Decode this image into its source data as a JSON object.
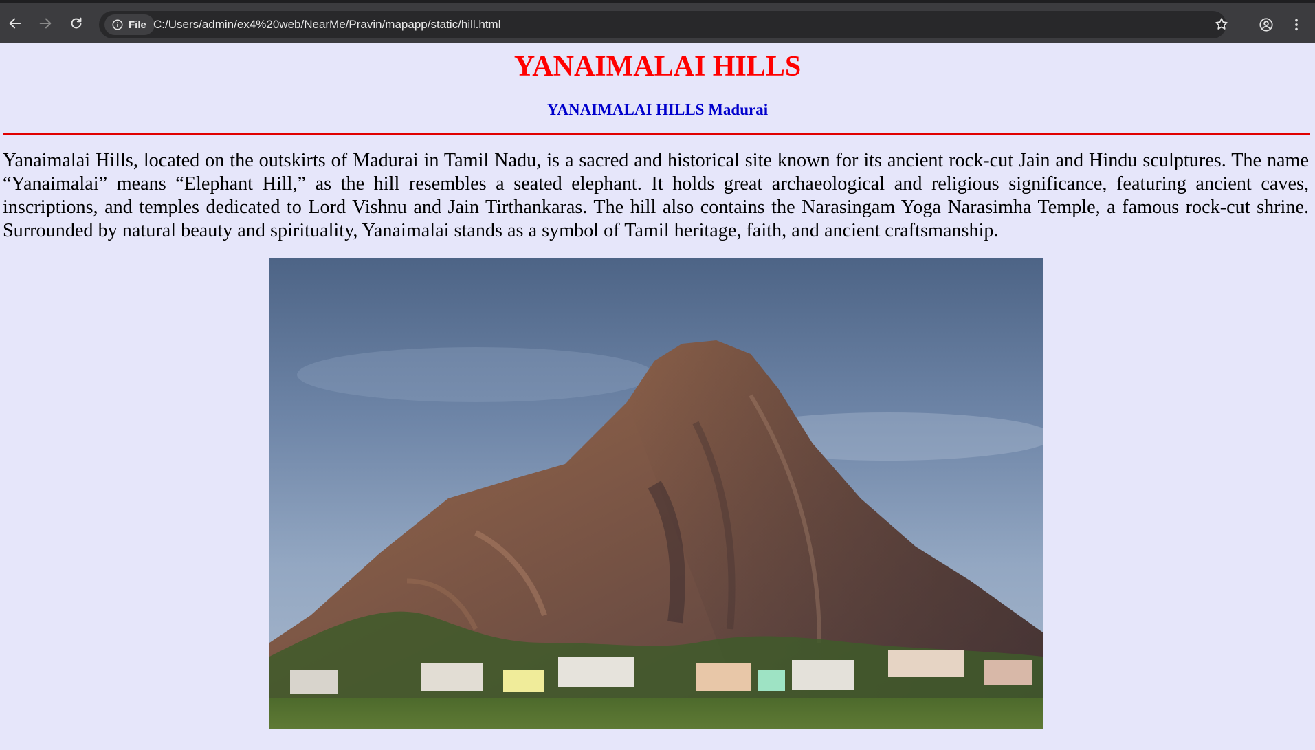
{
  "browser": {
    "file_chip_label": "File",
    "url": "C:/Users/admin/ex4%20web/NearMe/Pravin/mapapp/static/hill.html",
    "icons": [
      "back-arrow-icon",
      "forward-arrow-icon",
      "reload-icon",
      "info-icon",
      "star-icon",
      "profile-icon",
      "more-vert-icon"
    ]
  },
  "page": {
    "title": "YANAIMALAI HILLS",
    "subtitle": "YANAIMALAI HILLS Madurai",
    "description": "Yanaimalai Hills, located on the outskirts of Madurai in Tamil Nadu, is a sacred and historical site known for its ancient rock-cut Jain and Hindu sculptures. The name “Yanaimalai” means “Elephant Hill,” as the hill resembles a seated elephant. It holds great archaeological and religious significance, featuring ancient caves, inscriptions, and temples dedicated to Lord Vishnu and Jain Tirthankaras. The hill also contains the Narasingam Yoga Narasimha Temple, a famous rock-cut shrine. Surrounded by natural beauty and spirituality, Yanaimalai stands as a symbol of Tamil heritage, faith, and ancient craftsmanship."
  },
  "colors": {
    "page_background": "#e6e6fa",
    "title": "#ff0000",
    "subtitle": "#0000cc",
    "divider": "#e00000"
  }
}
